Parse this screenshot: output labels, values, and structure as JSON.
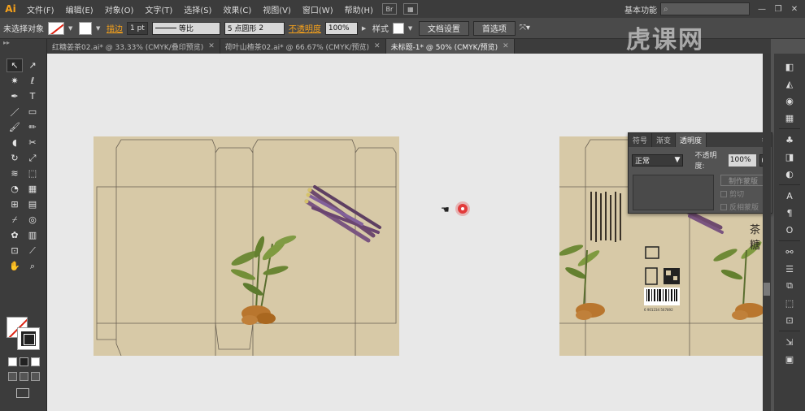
{
  "app": {
    "logo": "Ai"
  },
  "menu": {
    "items": [
      "文件(F)",
      "编辑(E)",
      "对象(O)",
      "文字(T)",
      "选择(S)",
      "效果(C)",
      "视图(V)",
      "窗口(W)",
      "帮助(H)"
    ],
    "bridge": "Br",
    "workspace": "基本功能",
    "window_buttons": [
      "—",
      "❐",
      "✕"
    ]
  },
  "control": {
    "selection": "未选择对象",
    "stroke_label": "描边",
    "stroke_weight": "1 pt",
    "stroke_profile": "等比",
    "brush": "5 点圆形",
    "brush_num": "2",
    "opacity_label": "不透明度",
    "opacity_value": "100%",
    "style_label": "样式",
    "doc_setup": "文档设置",
    "preferences": "首选项"
  },
  "tabs": [
    {
      "label": "红糖姜茶02.ai* @ 33.33% (CMYK/叠印预览)",
      "close": "✕"
    },
    {
      "label": "荷叶山楂茶02.ai* @ 66.67% (CMYK/预览)",
      "close": "✕"
    },
    {
      "label": "未标题-1* @ 50% (CMYK/预览)",
      "close": "✕"
    }
  ],
  "transparency_panel": {
    "tabs": [
      "符号",
      "渐变",
      "透明度"
    ],
    "menu": "≡",
    "blend_mode": "正常",
    "opacity_label": "不透明度:",
    "opacity_value": "100%",
    "make_mask": "制作蒙版",
    "clip": "剪切",
    "invert_mask": "反相蒙版"
  },
  "canvas_text": {
    "title_fragment": "茶糖",
    "barcode_number": "6 901234 567892"
  },
  "watermark": "虎课网",
  "colors": {
    "kraft_paper": "#d7c9a7",
    "accent_orange": "#f7a21b",
    "ui_dark": "#3c3c3c",
    "ui_mid": "#535353"
  }
}
